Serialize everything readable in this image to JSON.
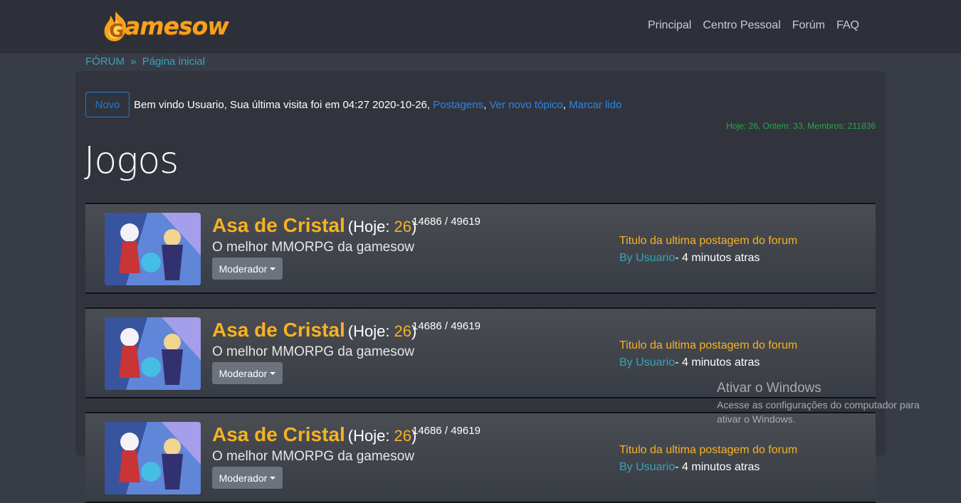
{
  "brand": {
    "logo_text": "amesow",
    "logo_letter": "G"
  },
  "nav": {
    "items": [
      "Principal",
      "Centro Pessoal",
      "Forúm",
      "FAQ"
    ]
  },
  "breadcrumb": {
    "root": "FÓRUM",
    "separator": "»",
    "current": "Página inicial"
  },
  "welcome": {
    "new_button": "Novo",
    "text": "Bem vindo Usuario, Sua última visita foi em 04:27 2020-10-26,",
    "link_posts": "Postagens",
    "link_new_topic": "Ver novo tópico",
    "link_mark_read": "Marcar lido",
    "comma": ","
  },
  "stats": "Hoje: 26, Ontem: 33, Membros: 211836",
  "section": {
    "title": "Jogos"
  },
  "forums": [
    {
      "name": "Asa de Cristal",
      "hoje_label": "(Hoje: ",
      "hoje_value": "26",
      "hoje_close": ")",
      "counts": "14686 / 49619",
      "description": "O melhor MMORPG da gamesow",
      "moderator_button": "Moderador",
      "last_post_title": "Titulo da ultima postagem do forum",
      "last_by_prefix": "By ",
      "last_by_user": "Usuario",
      "last_by_time": "- 4 minutos atras"
    },
    {
      "name": "Asa de Cristal",
      "hoje_label": "(Hoje: ",
      "hoje_value": "26",
      "hoje_close": ")",
      "counts": "14686 / 49619",
      "description": "O melhor MMORPG da gamesow",
      "moderator_button": "Moderador",
      "last_post_title": "Titulo da ultima postagem do forum",
      "last_by_prefix": "By ",
      "last_by_user": "Usuario",
      "last_by_time": "- 4 minutos atras"
    },
    {
      "name": "Asa de Cristal",
      "hoje_label": "(Hoje: ",
      "hoje_value": "26",
      "hoje_close": ")",
      "counts": "14686 / 49619",
      "description": "O melhor MMORPG da gamesow",
      "moderator_button": "Moderador",
      "last_post_title": "Titulo da ultima postagem do forum",
      "last_by_prefix": "By ",
      "last_by_user": "Usuario",
      "last_by_time": "- 4 minutos atras"
    }
  ],
  "watermark": {
    "title": "Ativar o Windows",
    "body": "Acesse as configurações do computador para ativar o Windows."
  },
  "colors": {
    "accent": "#f7b223",
    "link_blue": "#2a86e8",
    "link_teal": "#37a4b8",
    "stats_green": "#28a745",
    "background": "#383c47"
  }
}
